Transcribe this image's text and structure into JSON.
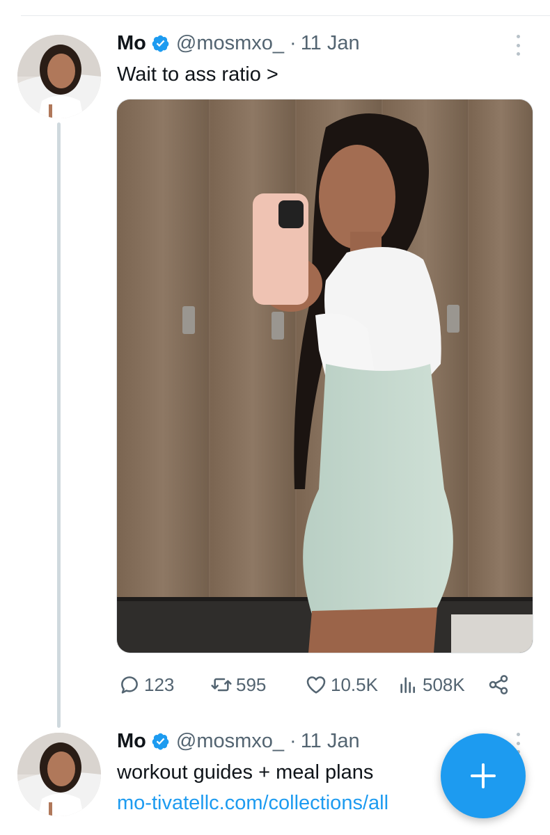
{
  "tweets": [
    {
      "author_name": "Mo",
      "handle": "@mosmxo_",
      "separator": "·",
      "date": "11 Jan",
      "text": "Wait to ass ratio >",
      "stats": {
        "replies": "123",
        "reposts": "595",
        "likes": "10.5K",
        "views": "508K"
      }
    },
    {
      "author_name": "Mo",
      "handle": "@mosmxo_",
      "separator": "·",
      "date": "11 Jan",
      "text": "workout guides + meal plans",
      "link": "mo-tivatellc.com/collections/all"
    }
  ],
  "icons": {
    "verified": "verified-badge-icon",
    "reply": "reply-icon",
    "repost": "repost-icon",
    "like": "heart-icon",
    "views": "views-icon",
    "share": "share-icon",
    "more": "more-options-icon",
    "compose": "plus-icon"
  },
  "colors": {
    "accent": "#1d9bf0",
    "muted": "#536471",
    "text": "#0f1419"
  }
}
